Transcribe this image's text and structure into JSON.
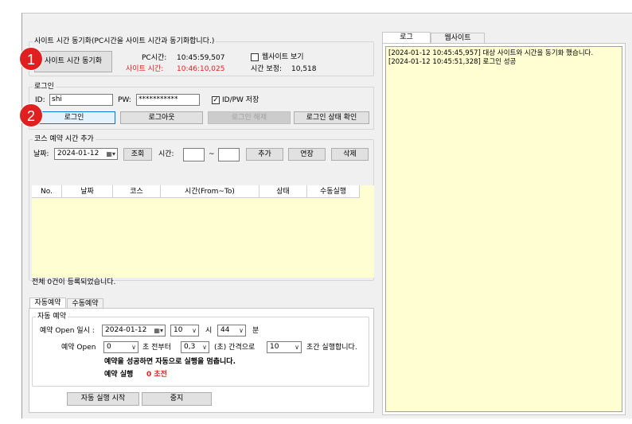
{
  "window": {
    "cursor_icon": "pointer-hand-icon"
  },
  "sync_group": {
    "title": "사이트 시간 동기화(PC시간을 사이트 시간과 동기화합니다.)",
    "sync_button": "사이트 시간 동기화",
    "pc_time_label": "PC시간:",
    "pc_time_value": "10:45:59,507",
    "site_time_label": "사이트 시간:",
    "site_time_value": "10:46:10,025",
    "show_website_label": "웹사이트 보기",
    "show_website_checked": false,
    "time_correction_label": "시간 보정:",
    "time_correction_value": "10,518"
  },
  "login_group": {
    "title": "로그인",
    "id_label": "ID:",
    "id_value": "shi",
    "pw_label": "PW:",
    "pw_value": "***********",
    "save_label": "ID/PW 저장",
    "save_checked": true,
    "login_button": "로그인",
    "logout_button": "로그아웃",
    "release_button": "로그인 해제",
    "status_button": "로그인 상태 확인"
  },
  "course_group": {
    "title": "코스 예약 시간 추가",
    "date_label": "날짜:",
    "date_value": "2024-01-12",
    "search_button": "조회",
    "time_label": "시간:",
    "time_from": "",
    "tilde": "~",
    "time_to": "",
    "add_button": "추가",
    "extend_button": "연장",
    "delete_button": "삭제"
  },
  "table": {
    "columns": [
      "No.",
      "날짜",
      "코스",
      "시간(From~To)",
      "상태",
      "수동실행"
    ],
    "rows": []
  },
  "status_text": "전체 0건이 등록되었습니다.",
  "reserve_tabs": [
    "자동예약",
    "수동예약"
  ],
  "auto_group": {
    "title": "자동 예약",
    "open_datetime_label": "예약 Open 일시 :",
    "open_date": "2024-01-12",
    "hour_value": "10",
    "hour_unit": "시",
    "minute_value": "44",
    "minute_unit": "분",
    "open_label": "예약 Open",
    "before_value": "0",
    "before_text": "초 전부터",
    "interval_value": "0,3",
    "interval_text": "(초) 간격으로",
    "duration_value": "10",
    "duration_text": "초간 실행합니다.",
    "notice": "예약을 성공하면 자동으로 실행을 멈춥니다.",
    "run_label": "예약 실행",
    "run_value": "0 초전",
    "start_button": "자동 실행 시작",
    "stop_button": "중지"
  },
  "right_tabs": [
    "로그",
    "웹사이트"
  ],
  "log_lines": [
    "[2024-01-12 10:45:45,957] 대상 사이트와 시간을 동기화 했습니다.",
    "[2024-01-12 10:45:51,328] 로그인 성공"
  ],
  "markers": [
    "1",
    "2"
  ],
  "colors": {
    "marker": "#e02020",
    "highlight_text": "#e02020",
    "log_background": "#fefed2",
    "grid_background": "#fefed2"
  }
}
